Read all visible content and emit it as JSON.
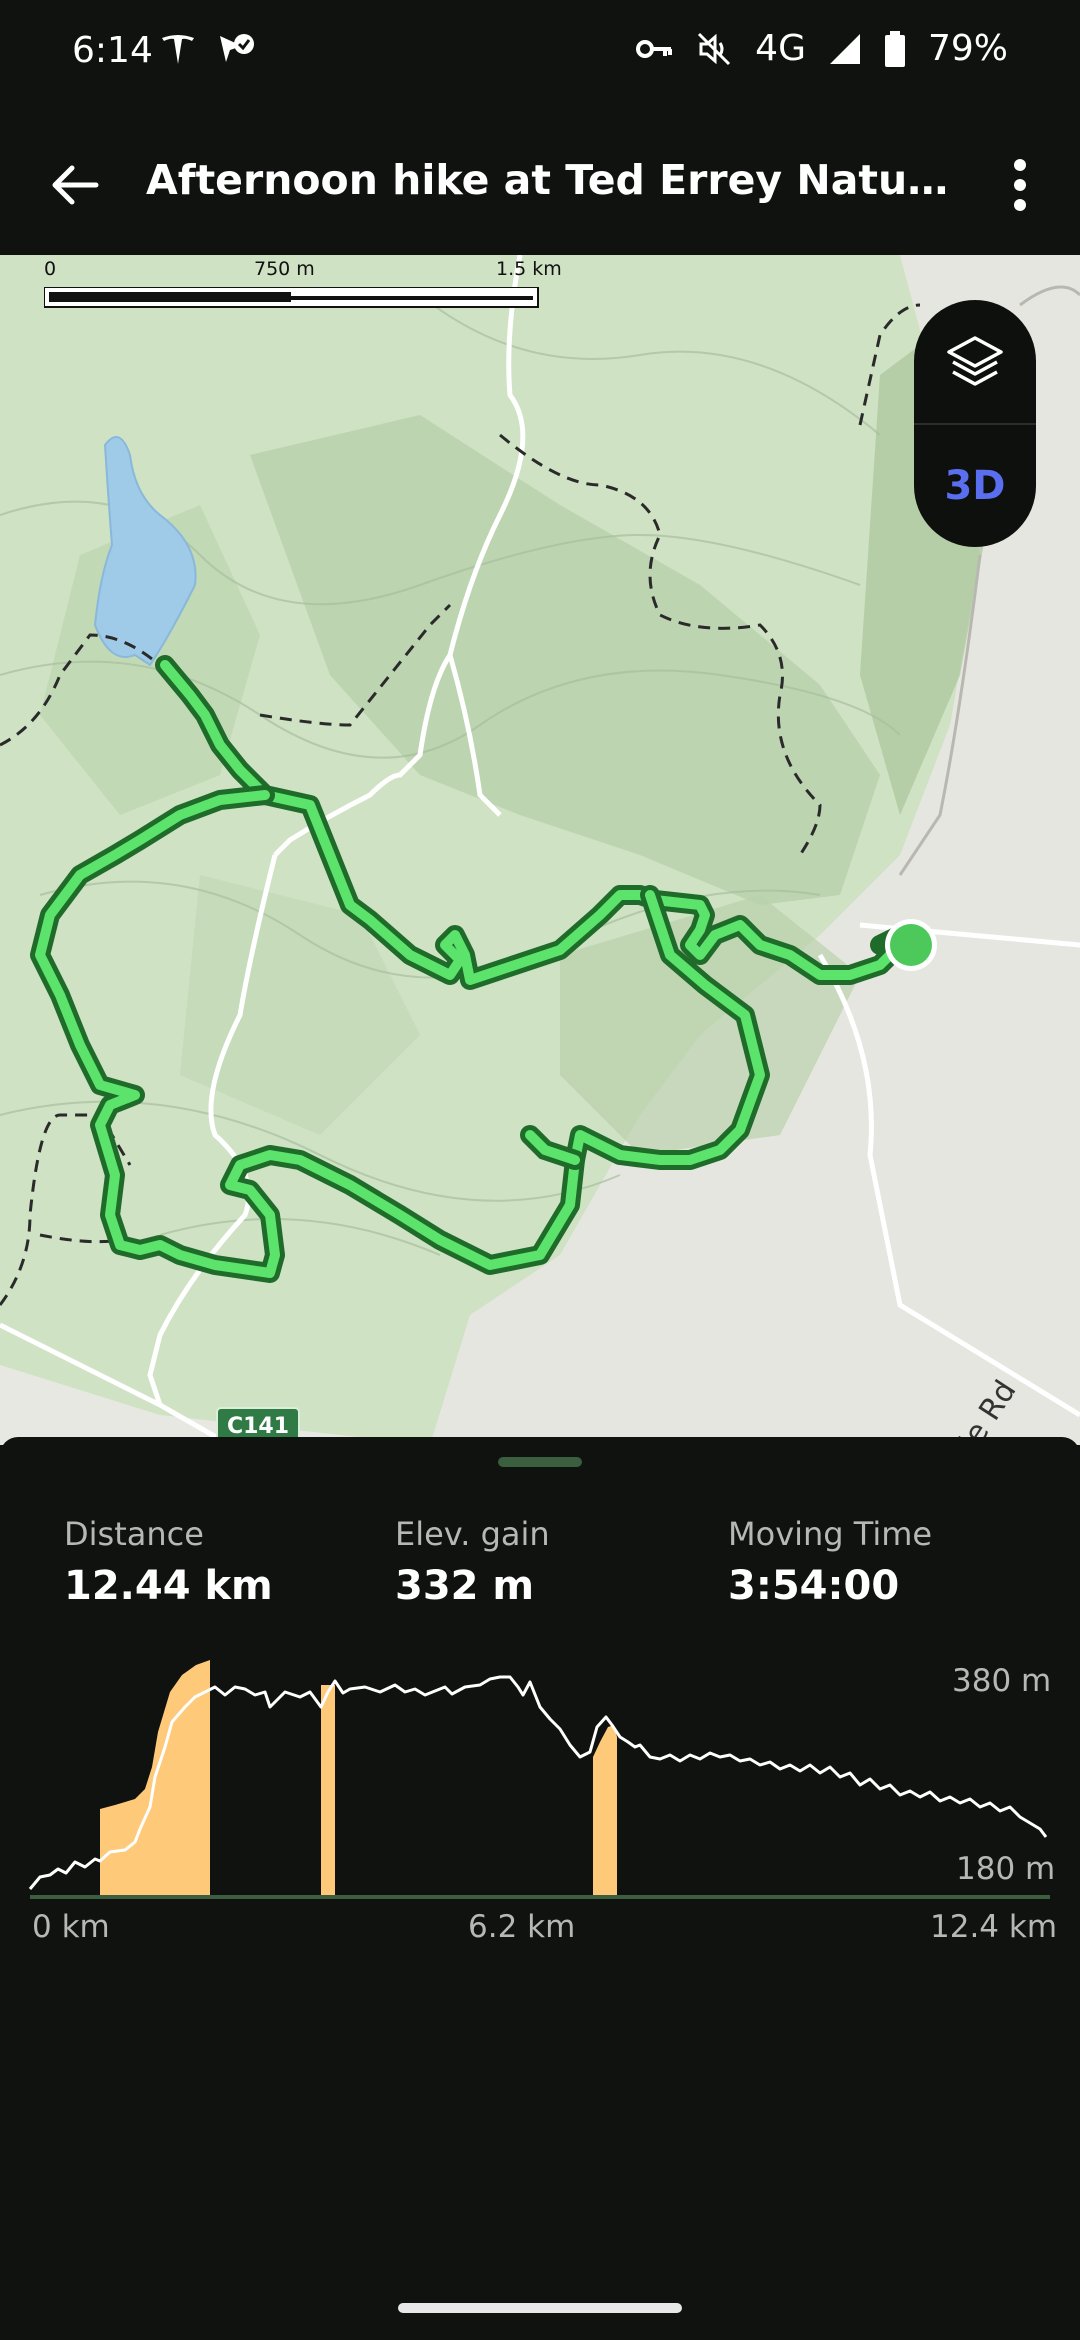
{
  "status_bar": {
    "time": "6:14",
    "network": "4G",
    "battery": "79%",
    "icons": [
      "tesla-icon",
      "location-check-icon",
      "vpn-key-icon",
      "mute-vibrate-icon",
      "signal-icon",
      "battery-icon"
    ]
  },
  "app_bar": {
    "title": "Afternoon hike at Ted Errey Nature Circ...",
    "back_icon": "arrow-back-icon",
    "menu_icon": "more-vert-icon"
  },
  "map": {
    "scale": {
      "left_label": "0",
      "mid_label": "750 m",
      "right_label": "1.5 km"
    },
    "controls": {
      "layers_icon": "layers-icon",
      "three_d_label": "3D"
    },
    "road_label": "ghton Vale Rd",
    "route_shield": "C141",
    "colors": {
      "track": "#5be36c",
      "track_outline": "#1f6b2a",
      "water": "#9fcbe8",
      "park": "#cfe2c3"
    }
  },
  "stats": [
    {
      "label": "Distance",
      "value": "12.44 km"
    },
    {
      "label": "Elev. gain",
      "value": "332 m"
    },
    {
      "label": "Moving Time",
      "value": "3:54:00"
    }
  ],
  "elevation_chart": {
    "x_labels": [
      "0 km",
      "6.2 km",
      "12.4 km"
    ],
    "y_top_label": "380 m",
    "y_bottom_label": "180 m",
    "highlight_color": "#ffc97a"
  }
}
